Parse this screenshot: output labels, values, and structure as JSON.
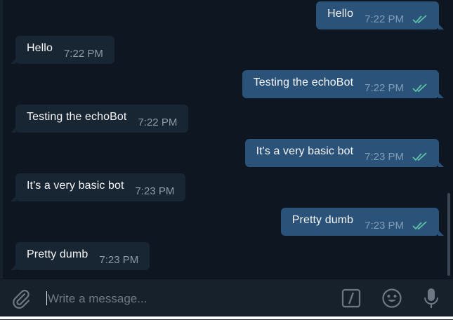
{
  "colors": {
    "chat_bg": "#0e1621",
    "bubble_in": "#182533",
    "bubble_out": "#2b5278",
    "read_check": "#5fc1a7"
  },
  "messages": [
    {
      "direction": "out",
      "text": "Hello",
      "time": "7:22 PM",
      "status": "read"
    },
    {
      "direction": "in",
      "text": "Hello",
      "time": "7:22 PM"
    },
    {
      "direction": "out",
      "text": "Testing the echoBot",
      "time": "7:22 PM",
      "status": "read"
    },
    {
      "direction": "in",
      "text": "Testing the echoBot",
      "time": "7:22 PM"
    },
    {
      "direction": "out",
      "text": "It's a very basic bot",
      "time": "7:23 PM",
      "status": "read"
    },
    {
      "direction": "in",
      "text": "It's a very basic bot",
      "time": "7:23 PM"
    },
    {
      "direction": "out",
      "text": "Pretty dumb",
      "time": "7:23 PM",
      "status": "read"
    },
    {
      "direction": "in",
      "text": "Pretty dumb",
      "time": "7:23 PM"
    }
  ],
  "composer": {
    "placeholder": "Write a message...",
    "value": "",
    "icons": [
      "paperclip-icon",
      "bot-command-icon",
      "emoji-icon",
      "microphone-icon"
    ]
  }
}
